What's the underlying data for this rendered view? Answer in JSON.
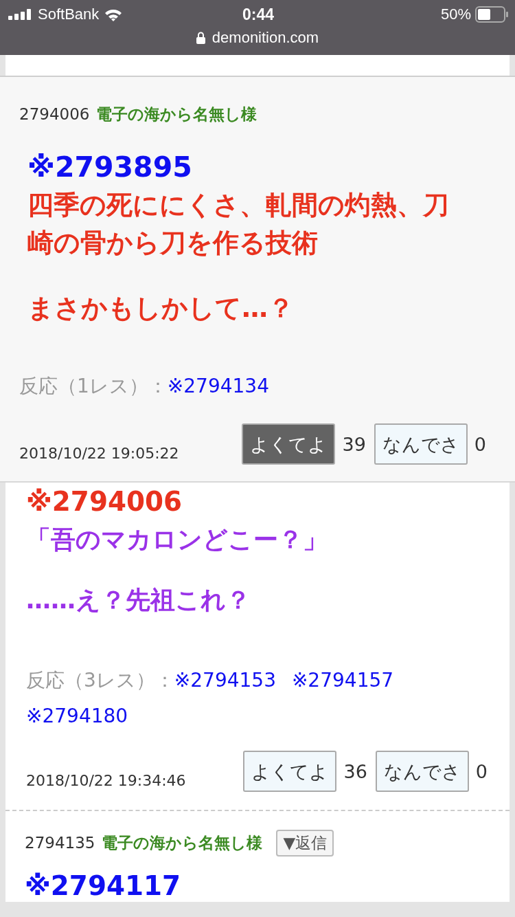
{
  "status_bar": {
    "carrier": "SoftBank",
    "time": "0:44",
    "battery": "50%",
    "url": "demonition.com"
  },
  "popup": {
    "number": "2794006",
    "name": "電子の海から名無し様",
    "paragraphs": [
      {
        "lines": [
          {
            "text": "※2793895",
            "kind": "anchor",
            "color": "#1010f0"
          },
          {
            "text": "四季の死ににくさ、軋間の灼熱、刀崎の骨から刀を作る技術",
            "kind": "text",
            "color": "#e8321e"
          }
        ]
      },
      {
        "lines": [
          {
            "text": "まさかもしかして…？",
            "kind": "text",
            "color": "#e8321e"
          }
        ]
      }
    ],
    "reactions_label": "反応（1レス）：",
    "reactions": [
      "※2794134"
    ],
    "date": "2018/10/22 19:05:22",
    "votes": [
      {
        "label": "よくてよ",
        "count": "39",
        "selected": true
      },
      {
        "label": "なんでさ",
        "count": "0",
        "selected": false
      }
    ]
  },
  "post": {
    "paragraphs": [
      {
        "lines": [
          {
            "text": "※2794006",
            "kind": "anchor",
            "color": "#e8321e"
          },
          {
            "text": "「吾のマカロンどこー？」",
            "kind": "text",
            "color": "#9a32e8"
          }
        ]
      },
      {
        "lines": [
          {
            "text": "……え？先祖これ？",
            "kind": "text",
            "color": "#9a32e8"
          }
        ]
      }
    ],
    "reactions_label": "反応（3レス）：",
    "reactions": [
      "※2794153",
      "※2794157",
      "※2794180"
    ],
    "date": "2018/10/22 19:34:46",
    "votes": [
      {
        "label": "よくてよ",
        "count": "36",
        "selected": false
      },
      {
        "label": "なんでさ",
        "count": "0",
        "selected": false
      }
    ]
  },
  "next_post": {
    "number": "2794135",
    "name": "電子の海から名無し様",
    "reply_button": "▼返信",
    "paragraphs": [
      {
        "lines": [
          {
            "text": "※2794117",
            "kind": "anchor",
            "color": "#1010f0"
          }
        ]
      }
    ]
  }
}
